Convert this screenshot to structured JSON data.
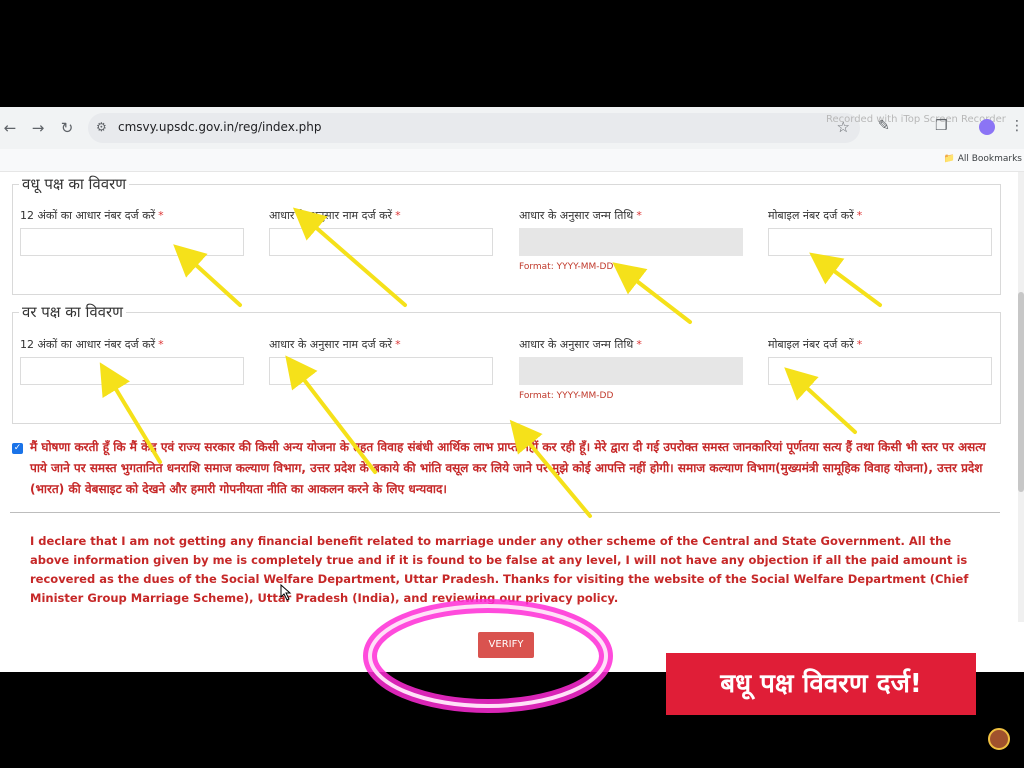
{
  "browser": {
    "url": "cmsvy.upsdc.gov.in/reg/index.php",
    "watermark": "Recorded with iTop Screen Recorder",
    "bookmarks_label": "All Bookmarks",
    "icons": [
      "back-icon",
      "forward-icon",
      "reload-icon",
      "site-info-icon",
      "star-icon",
      "eyedropper-icon",
      "extensions-icon",
      "menu-icon",
      "folder-icon"
    ]
  },
  "bride_section": {
    "title": "वधू पक्ष का विवरण",
    "fields": [
      {
        "label": "12 अंकों का आधार नंबर दर्ज करें",
        "required": "*",
        "value": ""
      },
      {
        "label": "आधार के अनुसार नाम दर्ज करें",
        "required": "*",
        "value": ""
      },
      {
        "label": "आधार के अनुसार जन्म तिथि",
        "required": "*",
        "value": "",
        "hint": "Format: YYYY-MM-DD"
      },
      {
        "label": "मोबाइल नंबर दर्ज करें",
        "required": "*",
        "value": ""
      }
    ]
  },
  "groom_section": {
    "title": "वर पक्ष का विवरण",
    "fields": [
      {
        "label": "12 अंकों का आधार नंबर दर्ज करें",
        "required": "*",
        "value": ""
      },
      {
        "label": "आधार के अनुसार नाम दर्ज करें",
        "required": "*",
        "value": ""
      },
      {
        "label": "आधार के अनुसार जन्म तिथि",
        "required": "*",
        "value": "",
        "hint": "Format: YYYY-MM-DD"
      },
      {
        "label": "मोबाइल नंबर दर्ज करें",
        "required": "*",
        "value": ""
      }
    ]
  },
  "declaration": {
    "checked": true,
    "hindi": "मैं घोषणा करती हूँ कि मैं केंद्र एवं राज्य सरकार की किसी अन्य योजना के तहत विवाह संबंधी आर्थिक लाभ प्राप्त नहीं कर रही हूँ। मेरे द्वारा दी गई उपरोक्त समस्त जानकारियां पूर्णतया सत्य हैं तथा किसी भी स्तर पर असत्य पाये जाने पर समस्त भुगतानित धनराशि समाज कल्याण विभाग, उत्तर प्रदेश के बकाये की भांति वसूल कर लिये जाने पर मुझे कोई आपत्ति नहीं होगी। समाज कल्याण विभाग(मुख्यमंत्री सामूहिक विवाह योजना), उत्तर प्रदेश (भारत) की वेबसाइट को देखने और हमारी गोपनीयता नीति का आकलन करने के लिए धन्यवाद।",
    "english": "I declare that I am not getting any financial benefit related to marriage under any other scheme of the Central and State Government. All the above information given by me is completely true and if it is found to be false at any level, I will not have any objection if all the paid amount is recovered as the dues of the Social Welfare Department, Uttar Pradesh. Thanks for visiting the website of the Social Welfare Department (Chief Minister Group Marriage Scheme), Uttar Pradesh (India), and reviewing our privacy policy."
  },
  "verify_button": "VERIFY",
  "caption": "बधू पक्ष विवरण दर्ज!",
  "colors": {
    "error_red": "#c62828",
    "button_red": "#d9534f",
    "caption_red": "#e01e37",
    "arrow_yellow": "#f5e11a",
    "highlight_magenta": "#ff2bd6"
  }
}
